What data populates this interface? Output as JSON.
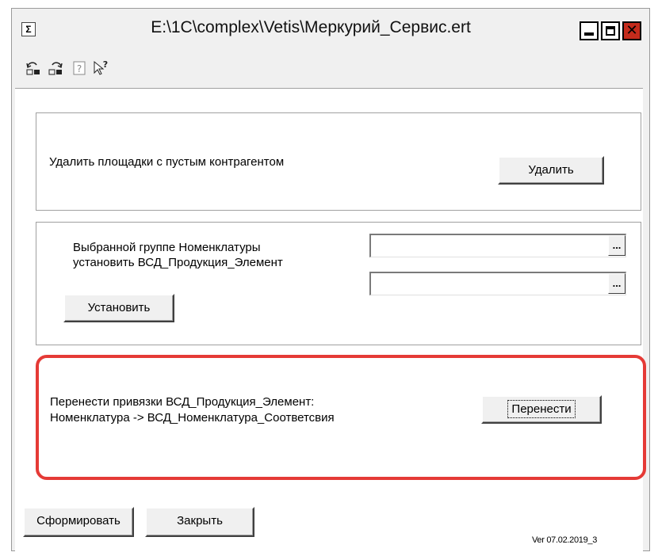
{
  "window": {
    "title": "E:\\1C\\complex\\Vetis\\Меркурий_Сервис.ert",
    "app_icon_glyph": "Σ"
  },
  "toolbar": {
    "icons": [
      "undo-icon",
      "redo-icon",
      "help-icon",
      "context-help-icon"
    ]
  },
  "panel_delete": {
    "label": "Удалить площадки с пустым контрагентом",
    "button": "Удалить"
  },
  "panel_set": {
    "label_line1": "Выбранной группе Номенклатуры",
    "label_line2": "установить ВСД_Продукция_Элемент",
    "input1_value": "",
    "input2_value": "",
    "ellipsis": "...",
    "button": "Установить"
  },
  "panel_transfer": {
    "label_line1": "Перенести привязки ВСД_Продукция_Элемент:",
    "label_line2": "Номенклатура -> ВСД_Номенклатура_Соответсвия",
    "button": "Перенести",
    "highlight_color": "#e53a36"
  },
  "footer": {
    "generate_button": "Сформировать",
    "close_button": "Закрыть",
    "version": "Ver 07.02.2019_3"
  }
}
